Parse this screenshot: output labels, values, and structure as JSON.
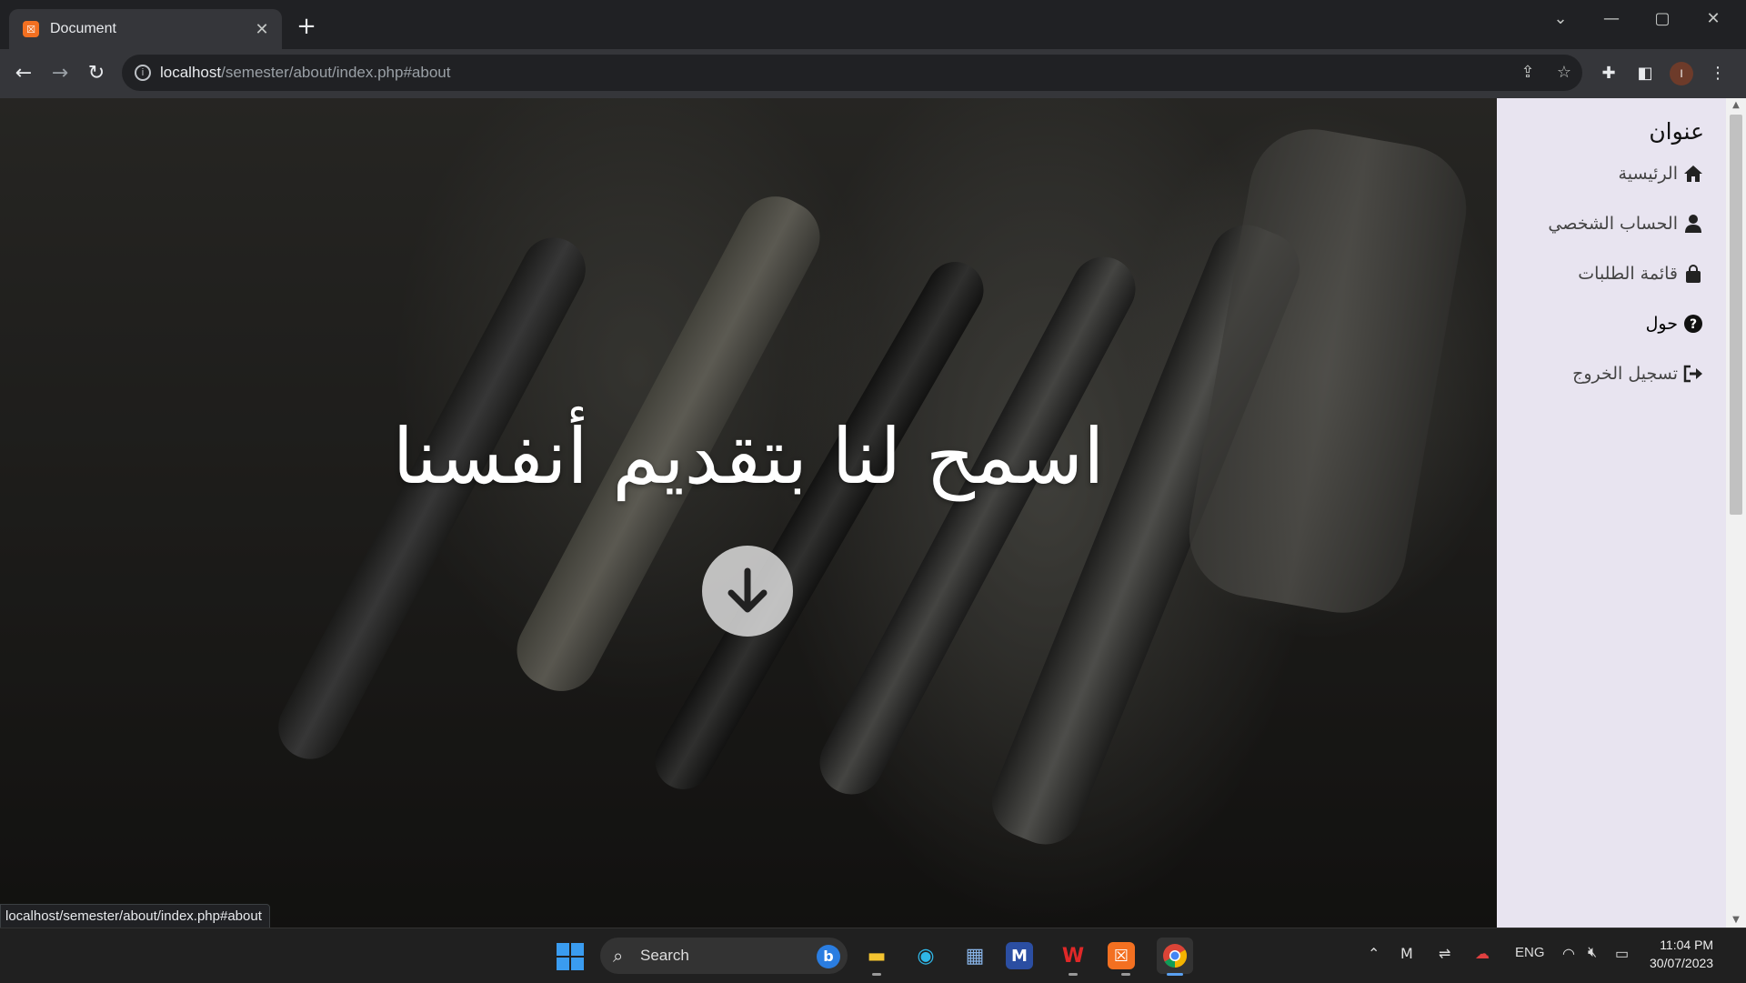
{
  "browser": {
    "tab_title": "Document",
    "tab_favicon": "xampp-icon",
    "url_host": "localhost",
    "url_path": "/semester/about/index.php#about",
    "status_url": "localhost/semester/about/index.php#about",
    "profile_initial": "I"
  },
  "hero": {
    "title": "اسمح لنا بتقديم أنفسنا"
  },
  "sidebar": {
    "title": "عنوان",
    "items": [
      {
        "label": "الرئيسية",
        "icon": "home-icon"
      },
      {
        "label": "الحساب الشخصي",
        "icon": "user-icon"
      },
      {
        "label": "قائمة الطلبات",
        "icon": "shopping-bag-icon"
      },
      {
        "label": "حول",
        "icon": "question-circle-icon"
      },
      {
        "label": "تسجيل الخروج",
        "icon": "logout-icon"
      }
    ]
  },
  "taskbar": {
    "search_label": "Search",
    "language": "ENG",
    "time": "11:04 PM",
    "date": "30/07/2023"
  }
}
